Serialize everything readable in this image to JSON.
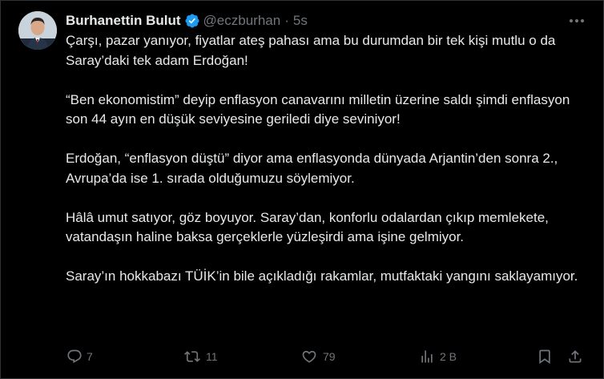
{
  "author": {
    "name": "Burhanettin Bulut",
    "handle": "@eczburhan",
    "separator": "·",
    "time": "5s",
    "verified": true,
    "avatar_icon": "user-avatar"
  },
  "tweet": {
    "paragraphs": [
      "Çarşı, pazar yanıyor, fiyatlar ateş pahası ama bu durumdan bir tek kişi mutlu o da Saray’daki tek adam Erdoğan!",
      "“Ben ekonomistim” deyip enflasyon canavarını milletin üzerine saldı şimdi enflasyon son 44 ayın en düşük seviyesine geriledi diye seviniyor!",
      "Erdoğan, “enflasyon düştü” diyor ama enflasyonda dünyada Arjantin’den sonra 2., Avrupa’da ise 1. sırada olduğumuzu söylemiyor.",
      "Hâlâ umut satıyor, göz boyuyor. Saray’dan, konforlu odalardan çıkıp memlekete, vatandaşın haline baksa gerçeklerle yüzleşirdi ama işine gelmiyor.",
      "Saray’ın hokkabazı TÜİK’in bile açıkladığı rakamlar, mutfaktaki yangını saklayamıyor."
    ]
  },
  "actions": {
    "reply": {
      "count": "7",
      "icon": "reply-icon"
    },
    "retweet": {
      "count": "11",
      "icon": "retweet-icon"
    },
    "like": {
      "count": "79",
      "icon": "heart-icon"
    },
    "views": {
      "count": "2 B",
      "icon": "views-icon"
    },
    "bookmark": {
      "icon": "bookmark-icon"
    },
    "share": {
      "icon": "share-icon"
    }
  },
  "colors": {
    "background": "#000000",
    "text_primary": "#e7e9ea",
    "text_secondary": "#71767b",
    "verified_badge": "#1d9bf0",
    "border": "#2f3336"
  }
}
